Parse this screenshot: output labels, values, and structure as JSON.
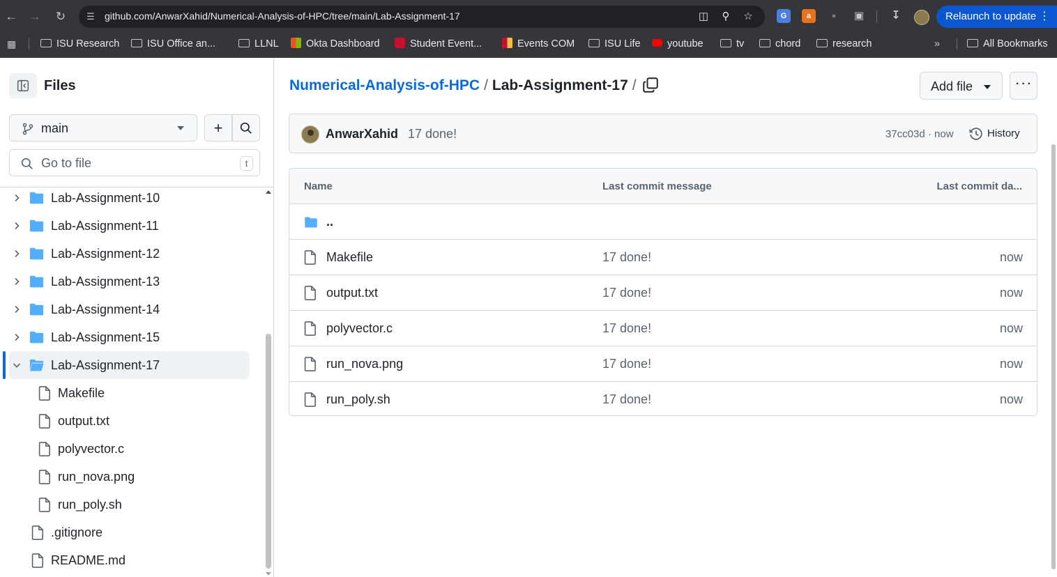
{
  "browser": {
    "url": "github.com/AnwarXahid/Numerical-Analysis-of-HPC/tree/main/Lab-Assignment-17",
    "relaunch_label": "Relaunch to update",
    "bookmarks": [
      {
        "label": "ISU Research"
      },
      {
        "label": "ISU Office an..."
      },
      {
        "label": "LLNL"
      },
      {
        "label": "Okta Dashboard"
      },
      {
        "label": "Student Event..."
      },
      {
        "label": "Events COM"
      },
      {
        "label": "ISU Life"
      },
      {
        "label": "youtube"
      },
      {
        "label": "tv"
      },
      {
        "label": "chord"
      },
      {
        "label": "research"
      }
    ],
    "all_bookmarks_label": "All Bookmarks",
    "overflow_label": "»"
  },
  "sidebar": {
    "title": "Files",
    "branch": "main",
    "search_placeholder": "Go to file",
    "search_shortcut": "t",
    "tree": [
      {
        "label": "Lab-Assignment-10",
        "type": "folder",
        "expanded": false
      },
      {
        "label": "Lab-Assignment-11",
        "type": "folder",
        "expanded": false
      },
      {
        "label": "Lab-Assignment-12",
        "type": "folder",
        "expanded": false
      },
      {
        "label": "Lab-Assignment-13",
        "type": "folder",
        "expanded": false
      },
      {
        "label": "Lab-Assignment-14",
        "type": "folder",
        "expanded": false
      },
      {
        "label": "Lab-Assignment-15",
        "type": "folder",
        "expanded": false
      },
      {
        "label": "Lab-Assignment-17",
        "type": "folder",
        "expanded": true,
        "selected": true
      },
      {
        "label": "Makefile",
        "type": "file",
        "depth": 1
      },
      {
        "label": "output.txt",
        "type": "file",
        "depth": 1
      },
      {
        "label": "polyvector.c",
        "type": "file",
        "depth": 1
      },
      {
        "label": "run_nova.png",
        "type": "file",
        "depth": 1
      },
      {
        "label": "run_poly.sh",
        "type": "file",
        "depth": 1
      },
      {
        "label": ".gitignore",
        "type": "file",
        "depth": 0
      },
      {
        "label": "README.md",
        "type": "file",
        "depth": 0
      }
    ]
  },
  "breadcrumb": {
    "repo": "Numerical-Analysis-of-HPC",
    "separator": "/",
    "current": "Lab-Assignment-17",
    "trailing": "/"
  },
  "actions": {
    "add_file_label": "Add file",
    "more_label": "···"
  },
  "commit": {
    "author": "AnwarXahid",
    "message": "17 done!",
    "sha_time": "37cc03d · now",
    "history_label": "History"
  },
  "table": {
    "headers": [
      "Name",
      "Last commit message",
      "Last commit da..."
    ],
    "parent_label": "..",
    "rows": [
      {
        "name": "Makefile",
        "message": "17 done!",
        "date": "now"
      },
      {
        "name": "output.txt",
        "message": "17 done!",
        "date": "now"
      },
      {
        "name": "polyvector.c",
        "message": "17 done!",
        "date": "now"
      },
      {
        "name": "run_nova.png",
        "message": "17 done!",
        "date": "now"
      },
      {
        "name": "run_poly.sh",
        "message": "17 done!",
        "date": "now"
      }
    ]
  },
  "colors": {
    "accent": "#0969da",
    "folder": "#54aeff",
    "chrome_bg": "#35363a",
    "relaunch": "#0b57d0"
  }
}
